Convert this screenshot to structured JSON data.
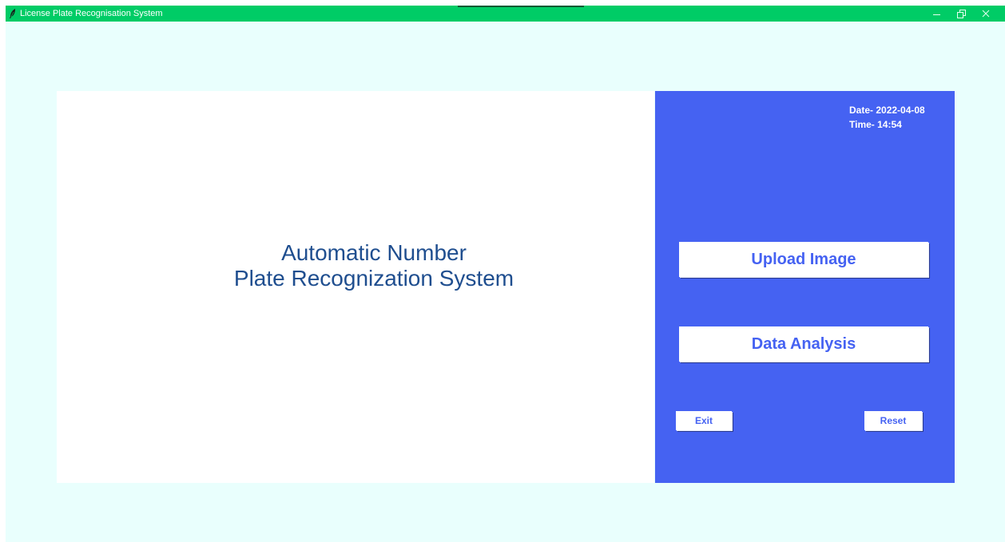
{
  "window": {
    "title": "License Plate Recognisation System",
    "icon": "feather-icon",
    "controls": [
      "minimize-icon",
      "restore-icon",
      "close-icon"
    ]
  },
  "main": {
    "title_line1": "Automatic Number",
    "title_line2": "Plate Recognization System"
  },
  "sidebar": {
    "date_text": "Date- 2022-04-08",
    "time_text": "Time- 14:54",
    "upload_label": "Upload Image",
    "analysis_label": "Data Analysis",
    "exit_label": "Exit",
    "reset_label": "Reset"
  },
  "colors": {
    "titlebar": "#00cc66",
    "background": "#e9fffd",
    "accent_panel": "#4562f2",
    "title_text": "#1f4e8f",
    "button_text": "#4562f2"
  }
}
